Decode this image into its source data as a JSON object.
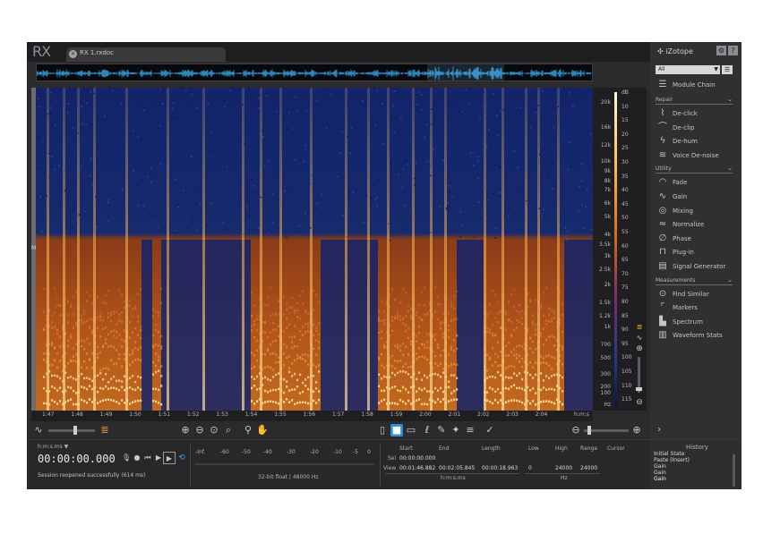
{
  "app": {
    "logo": "RX",
    "tab_label": "RX 1.rxdoc",
    "brand": "iZotope",
    "settings_icon": "gear-icon",
    "help_label": "?"
  },
  "spectrogram": {
    "side_label": "M",
    "freq_ticks": [
      "20k",
      "16k",
      "12k",
      "10k",
      "9k",
      "8k",
      "7k",
      "6k",
      "5k",
      "4k",
      "3.5k",
      "3k",
      "2.5k",
      "2k",
      "1.5k",
      "1.2k",
      "1k",
      "700",
      "500",
      "300",
      "200",
      "100",
      "Hz"
    ],
    "db_ticks": [
      "dB",
      "10",
      "15",
      "20",
      "25",
      "30",
      "35",
      "40",
      "45",
      "50",
      "55",
      "60",
      "65",
      "70",
      "75",
      "80",
      "85",
      "90",
      "95",
      "100",
      "105",
      "110",
      "115"
    ],
    "time_ticks": [
      "1:47",
      "1:48",
      "1:49",
      "1:50",
      "1:51",
      "1:52",
      "1:53",
      "1:54",
      "1:55",
      "1:56",
      "1:57",
      "1:58",
      "1:59",
      "2:00",
      "2:01",
      "2:02",
      "2:03",
      "2:04"
    ],
    "time_unit": "h:m:s"
  },
  "panel": {
    "filter_value": "All",
    "module_chain": "Module Chain",
    "sections": [
      {
        "name": "Repair",
        "items": [
          {
            "label": "De-click",
            "icon": "declick-icon"
          },
          {
            "label": "De-clip",
            "icon": "declip-icon"
          },
          {
            "label": "De-hum",
            "icon": "dehum-icon"
          },
          {
            "label": "Voice De-noise",
            "icon": "voice-denoise-icon"
          }
        ]
      },
      {
        "name": "Utility",
        "items": [
          {
            "label": "Fade",
            "icon": "fade-icon"
          },
          {
            "label": "Gain",
            "icon": "gain-icon"
          },
          {
            "label": "Mixing",
            "icon": "mixing-icon"
          },
          {
            "label": "Normalize",
            "icon": "normalize-icon"
          },
          {
            "label": "Phase",
            "icon": "phase-icon"
          },
          {
            "label": "Plug-in",
            "icon": "plugin-icon"
          },
          {
            "label": "Signal Generator",
            "icon": "signal-generator-icon"
          }
        ]
      },
      {
        "name": "Measurements",
        "items": [
          {
            "label": "Find Similar",
            "icon": "find-similar-icon"
          },
          {
            "label": "Markers",
            "icon": "markers-icon"
          },
          {
            "label": "Spectrum",
            "icon": "spectrum-icon"
          },
          {
            "label": "Waveform Stats",
            "icon": "waveform-stats-icon"
          }
        ]
      }
    ]
  },
  "transport": {
    "time_format": "h:m:s.ms ▼",
    "time": "00:00:00.000",
    "status": "Session reopened successfully (614 ms)"
  },
  "meter": {
    "ticks": [
      "-Inf.",
      "-60",
      "-50",
      "-40",
      "-30",
      "-20",
      "-10",
      "-5",
      "0"
    ],
    "format": "32-bit float | 48000 Hz"
  },
  "selection": {
    "headers": {
      "start": "Start",
      "end": "End",
      "length": "Length",
      "low": "Low",
      "high": "High",
      "range": "Range",
      "cursor": "Cursor"
    },
    "sel_label": "Sel",
    "sel_start": "00:00:00.000",
    "view_label": "View",
    "view_start": "00:01:46.882",
    "view_end": "00:02:05.845",
    "view_length": "00:00:18.963",
    "view_low": "0",
    "view_high": "24000",
    "view_range": "24000",
    "time_unit": "h:m:s.ms",
    "freq_unit": "Hz"
  },
  "history": {
    "title": "History",
    "items": [
      "Initial State",
      "Paste (Insert)",
      "Gain",
      "Gain",
      "Gain"
    ]
  },
  "colors": {
    "background": "#2b2b2d",
    "spectrogram_low": "#10205a",
    "spectrogram_high": "#ffb54a",
    "accent": "#2f8fd8",
    "overview_wave": "#3aa7e8"
  }
}
